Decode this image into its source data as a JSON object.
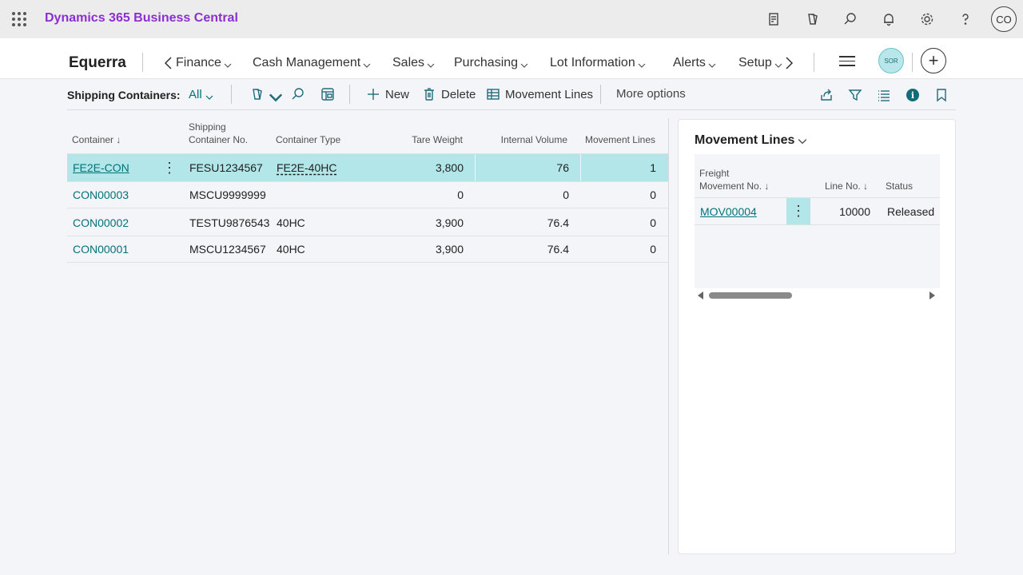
{
  "app": {
    "title": "Dynamics 365 Business Central",
    "user_initials": "CO"
  },
  "topbar_icons": [
    "report-icon",
    "copilot-icon",
    "search-icon",
    "bell-icon",
    "gear-icon",
    "help-icon"
  ],
  "nav": {
    "company": "Equerra",
    "items": [
      {
        "label": "Finance"
      },
      {
        "label": "Cash Management"
      },
      {
        "label": "Sales"
      },
      {
        "label": "Purchasing"
      },
      {
        "label": "Lot Information"
      },
      {
        "label": "Alerts"
      },
      {
        "label": "Setup"
      }
    ],
    "badge": "SOR"
  },
  "actionbar": {
    "caption": "Shipping Containers:",
    "filter": "All",
    "new_label": "New",
    "delete_label": "Delete",
    "movement_lines_label": "Movement Lines",
    "more_options_label": "More options"
  },
  "list": {
    "columns": {
      "container": "Container",
      "shipping_no_1": "Shipping",
      "shipping_no_2": "Container No.",
      "container_type": "Container Type",
      "tare_weight": "Tare Weight",
      "internal_volume": "Internal Volume",
      "movement_lines": "Movement Lines"
    },
    "rows": [
      {
        "container": "FE2E-CON",
        "shipping_no": "FESU1234567",
        "type": "FE2E-40HC",
        "tare": "3,800",
        "volume": "76",
        "lines": "1"
      },
      {
        "container": "CON00003",
        "shipping_no": "MSCU9999999",
        "type": "",
        "tare": "0",
        "volume": "0",
        "lines": "0"
      },
      {
        "container": "CON00002",
        "shipping_no": "TESTU9876543",
        "type": "40HC",
        "tare": "3,900",
        "volume": "76.4",
        "lines": "0"
      },
      {
        "container": "CON00001",
        "shipping_no": "MSCU1234567",
        "type": "40HC",
        "tare": "3,900",
        "volume": "76.4",
        "lines": "0"
      }
    ]
  },
  "factbox": {
    "title": "Movement Lines",
    "columns": {
      "freight_1": "Freight",
      "freight_2": "Movement No.",
      "line_no": "Line No.",
      "status": "Status"
    },
    "rows": [
      {
        "movement_no": "MOV00004",
        "line_no": "10000",
        "status": "Released"
      }
    ]
  },
  "colors": {
    "accent": "#00727a",
    "app_title": "#8b2fd0",
    "selected_row": "#b2e6e9"
  }
}
